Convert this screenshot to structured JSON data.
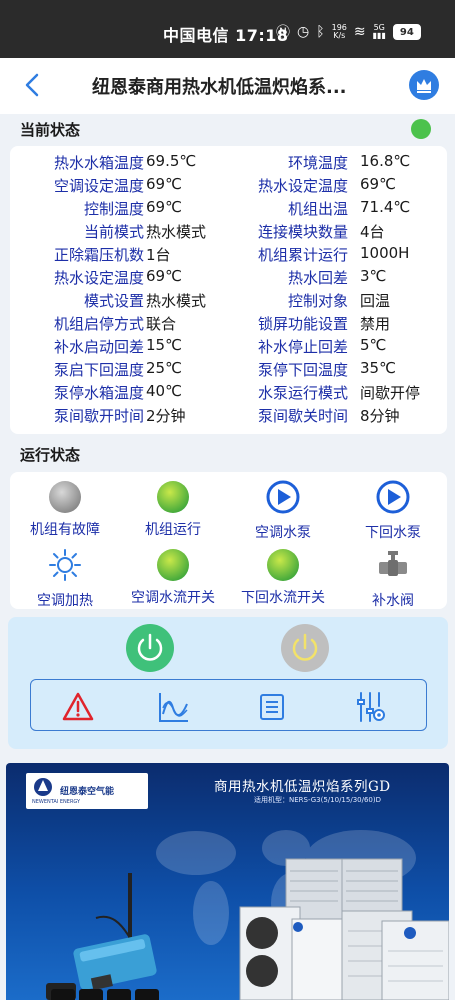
{
  "status_bar": {
    "carrier_time": "中国电信 17:18",
    "network_speed_top": "196",
    "network_speed_unit": "K/s",
    "signal_label": "5G",
    "battery": "94"
  },
  "header": {
    "title": "纽恩泰商用热水机低温炽焰系..."
  },
  "current_status": {
    "title": "当前状态",
    "rows": [
      {
        "left_label": "热水水箱温度",
        "left_value": "69.5℃",
        "right_label": "环境温度",
        "right_value": "16.8℃"
      },
      {
        "left_label": "空调设定温度",
        "left_value": "69℃",
        "right_label": "热水设定温度",
        "right_value": "69℃"
      },
      {
        "left_label": "控制温度",
        "left_value": "69℃",
        "right_label": "机组出温",
        "right_value": "71.4℃"
      },
      {
        "left_label": "当前模式",
        "left_value": "热水模式",
        "right_label": "连接模块数量",
        "right_value": "4台"
      },
      {
        "left_label": "正除霜压机数",
        "left_value": "1台",
        "right_label": "机组累计运行",
        "right_value": "1000H"
      },
      {
        "left_label": "热水设定温度",
        "left_value": "69℃",
        "right_label": "热水回差",
        "right_value": "3℃"
      },
      {
        "left_label": "模式设置",
        "left_value": "热水模式",
        "right_label": "控制对象",
        "right_value": "回温"
      },
      {
        "left_label": "机组启停方式",
        "left_value": "联合",
        "right_label": "锁屏功能设置",
        "right_value": "禁用"
      },
      {
        "left_label": "补水启动回差",
        "left_value": "15℃",
        "right_label": "补水停止回差",
        "right_value": "5℃"
      },
      {
        "left_label": "泵启下回温度",
        "left_value": "25℃",
        "right_label": "泵停下回温度",
        "right_value": "35℃"
      },
      {
        "left_label": "泵停水箱温度",
        "left_value": "40℃",
        "right_label": "水泵运行模式",
        "right_value": "间歇开停"
      },
      {
        "left_label": "泵间歇开时间",
        "left_value": "2分钟",
        "right_label": "泵间歇关时间",
        "right_value": "8分钟"
      }
    ]
  },
  "run_status": {
    "title": "运行状态",
    "items": [
      {
        "label": "机组有故障",
        "icon": "status-light-off"
      },
      {
        "label": "机组运行",
        "icon": "status-light-on"
      },
      {
        "label": "空调水泵",
        "icon": "pump-icon"
      },
      {
        "label": "下回水泵",
        "icon": "pump-icon"
      },
      {
        "label": "空调加热",
        "icon": "sun-icon"
      },
      {
        "label": "空调水流开关",
        "icon": "status-light-on"
      },
      {
        "label": "下回水流开关",
        "icon": "status-light-on"
      },
      {
        "label": "补水阀",
        "icon": "valve-icon"
      }
    ]
  },
  "controls": {
    "power_on": "power-on-icon",
    "power_off": "power-off-icon",
    "tools": [
      "alarm-icon",
      "chart-icon",
      "list-icon",
      "settings-sliders-icon"
    ]
  },
  "banner": {
    "logo_text": "纽恩泰空气能",
    "logo_sub": "NEWENTAI ENERGY",
    "title": "商用热水机低温炽焰系列GD",
    "model": "适用机型：NERS-G3(5/10/15/30/60)D"
  },
  "colors": {
    "accent_blue": "#2f7de1",
    "label_blue": "#1d2fa8",
    "green": "#3fc17a",
    "status_dot": "#4cc24c"
  }
}
